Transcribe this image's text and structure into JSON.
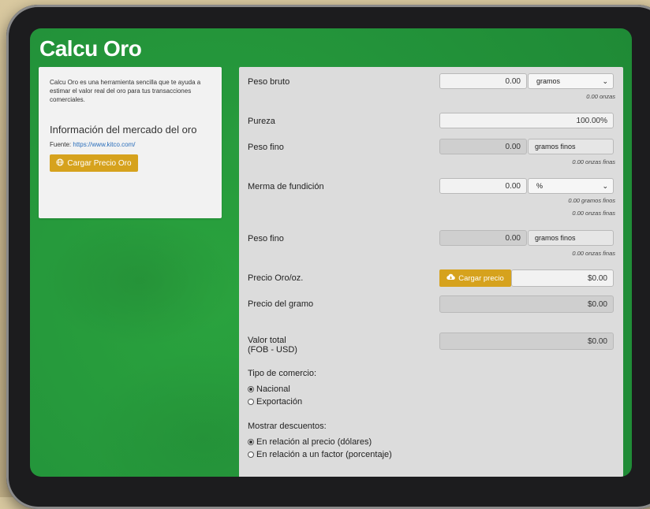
{
  "app": {
    "title": "Calcu Oro"
  },
  "info": {
    "description": "Calcu Oro es una herramienta sencilla que te ayuda a estimar el valor real del oro para tus transacciones comerciales.",
    "heading": "Información del mercado del oro",
    "source_label": "Fuente:",
    "source_link": "https://www.kitco.com/",
    "button_label": "Cargar Precio Oro"
  },
  "form": {
    "peso_bruto": {
      "label": "Peso bruto",
      "value": "0.00",
      "unit": "gramos",
      "note": "0.00 onzas"
    },
    "pureza": {
      "label": "Pureza",
      "value": "100.00%"
    },
    "peso_fino_1": {
      "label": "Peso fino",
      "value": "0.00",
      "unit": "gramos finos",
      "note": "0.00 onzas finas"
    },
    "merma": {
      "label": "Merma de fundición",
      "value": "0.00",
      "unit": "%",
      "note1": "0.00 gramos finos",
      "note2": "0.00 onzas finas"
    },
    "peso_fino_2": {
      "label": "Peso fino",
      "value": "0.00",
      "unit": "gramos finos",
      "note": "0.00 onzas finas"
    },
    "precio_oz": {
      "label": "Precio Oro/oz.",
      "button": "Cargar precio",
      "value": "$0.00"
    },
    "precio_gramo": {
      "label": "Precio del gramo",
      "value": "$0.00"
    },
    "valor_total": {
      "label1": "Valor total",
      "label2": "(FOB - USD)",
      "value": "$0.00"
    },
    "tipo_comercio": {
      "label": "Tipo de comercio:",
      "options": [
        "Nacional",
        "Exportación"
      ],
      "selected": "Nacional"
    },
    "descuentos": {
      "label": "Mostrar descuentos:",
      "options": [
        "En relación al precio (dólares)",
        "En relación a un factor (porcentaje)"
      ],
      "selected": "En relación al precio (dólares)"
    }
  }
}
